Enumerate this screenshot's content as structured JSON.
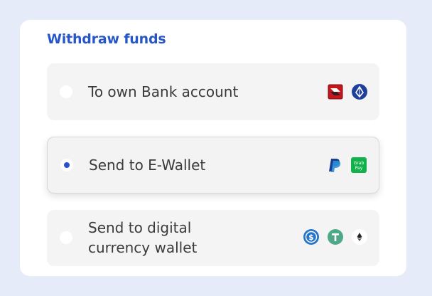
{
  "title": "Withdraw funds",
  "options": [
    {
      "label": "To own Bank account",
      "selected": false,
      "icons": [
        "dbs-bank-icon",
        "ocbc-bank-icon"
      ]
    },
    {
      "label": "Send to E-Wallet",
      "selected": true,
      "icons": [
        "paypal-icon",
        "grabpay-icon"
      ]
    },
    {
      "label": "Send to digital currency wallet",
      "selected": false,
      "icons": [
        "usdc-icon",
        "tether-icon",
        "ethereum-icon"
      ]
    }
  ],
  "grabpay_icon_text": {
    "line1": "Grab",
    "line2": "Pay"
  },
  "colors": {
    "background": "#e5ebf8",
    "title": "#2756c8",
    "radio_selected": "#2a52cc",
    "option_bg": "#f4f4f4"
  }
}
